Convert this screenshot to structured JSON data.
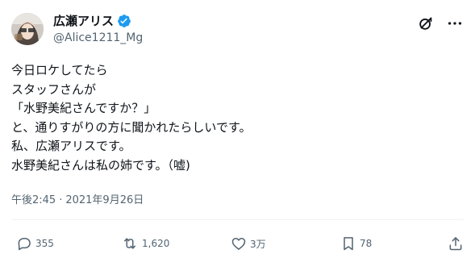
{
  "author": {
    "display_name": "広瀬アリス",
    "handle": "@Alice1211_Mg",
    "verified_icon": "verified-badge-icon",
    "verified_color": "#1d9bf0"
  },
  "header_actions": {
    "grok_icon": "grok-icon",
    "more_icon": "more-icon"
  },
  "tweet": {
    "lines": [
      "今日ロケしてたら",
      "スタッフさんが",
      "「水野美紀さんですか？」",
      "と、通りすがりの方に聞かれたらしいです。",
      "私、広瀬アリスです。",
      "水野美紀さんは私の姉です。（嘘)"
    ],
    "time": "午後2:45",
    "separator": "·",
    "date": "2021年9月26日"
  },
  "actions": {
    "reply_count": "355",
    "retweet_count": "1,620",
    "like_count": "3万",
    "bookmark_count": "78"
  },
  "colors": {
    "text": "#0f1419",
    "secondary": "#536471",
    "divider": "#eff3f4"
  }
}
